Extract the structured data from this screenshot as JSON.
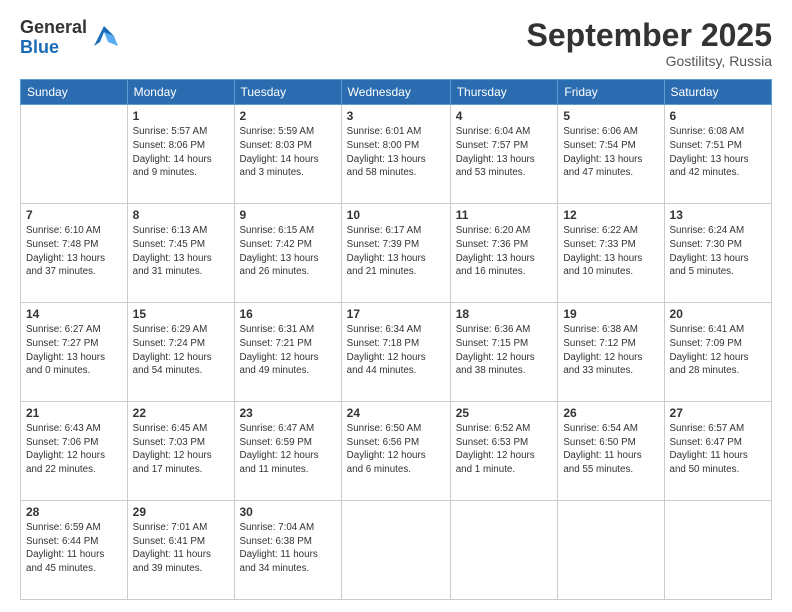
{
  "logo": {
    "general": "General",
    "blue": "Blue"
  },
  "header": {
    "month": "September 2025",
    "location": "Gostilitsy, Russia"
  },
  "weekdays": [
    "Sunday",
    "Monday",
    "Tuesday",
    "Wednesday",
    "Thursday",
    "Friday",
    "Saturday"
  ],
  "weeks": [
    [
      {
        "day": "",
        "info": ""
      },
      {
        "day": "1",
        "info": "Sunrise: 5:57 AM\nSunset: 8:06 PM\nDaylight: 14 hours\nand 9 minutes."
      },
      {
        "day": "2",
        "info": "Sunrise: 5:59 AM\nSunset: 8:03 PM\nDaylight: 14 hours\nand 3 minutes."
      },
      {
        "day": "3",
        "info": "Sunrise: 6:01 AM\nSunset: 8:00 PM\nDaylight: 13 hours\nand 58 minutes."
      },
      {
        "day": "4",
        "info": "Sunrise: 6:04 AM\nSunset: 7:57 PM\nDaylight: 13 hours\nand 53 minutes."
      },
      {
        "day": "5",
        "info": "Sunrise: 6:06 AM\nSunset: 7:54 PM\nDaylight: 13 hours\nand 47 minutes."
      },
      {
        "day": "6",
        "info": "Sunrise: 6:08 AM\nSunset: 7:51 PM\nDaylight: 13 hours\nand 42 minutes."
      }
    ],
    [
      {
        "day": "7",
        "info": "Sunrise: 6:10 AM\nSunset: 7:48 PM\nDaylight: 13 hours\nand 37 minutes."
      },
      {
        "day": "8",
        "info": "Sunrise: 6:13 AM\nSunset: 7:45 PM\nDaylight: 13 hours\nand 31 minutes."
      },
      {
        "day": "9",
        "info": "Sunrise: 6:15 AM\nSunset: 7:42 PM\nDaylight: 13 hours\nand 26 minutes."
      },
      {
        "day": "10",
        "info": "Sunrise: 6:17 AM\nSunset: 7:39 PM\nDaylight: 13 hours\nand 21 minutes."
      },
      {
        "day": "11",
        "info": "Sunrise: 6:20 AM\nSunset: 7:36 PM\nDaylight: 13 hours\nand 16 minutes."
      },
      {
        "day": "12",
        "info": "Sunrise: 6:22 AM\nSunset: 7:33 PM\nDaylight: 13 hours\nand 10 minutes."
      },
      {
        "day": "13",
        "info": "Sunrise: 6:24 AM\nSunset: 7:30 PM\nDaylight: 13 hours\nand 5 minutes."
      }
    ],
    [
      {
        "day": "14",
        "info": "Sunrise: 6:27 AM\nSunset: 7:27 PM\nDaylight: 13 hours\nand 0 minutes."
      },
      {
        "day": "15",
        "info": "Sunrise: 6:29 AM\nSunset: 7:24 PM\nDaylight: 12 hours\nand 54 minutes."
      },
      {
        "day": "16",
        "info": "Sunrise: 6:31 AM\nSunset: 7:21 PM\nDaylight: 12 hours\nand 49 minutes."
      },
      {
        "day": "17",
        "info": "Sunrise: 6:34 AM\nSunset: 7:18 PM\nDaylight: 12 hours\nand 44 minutes."
      },
      {
        "day": "18",
        "info": "Sunrise: 6:36 AM\nSunset: 7:15 PM\nDaylight: 12 hours\nand 38 minutes."
      },
      {
        "day": "19",
        "info": "Sunrise: 6:38 AM\nSunset: 7:12 PM\nDaylight: 12 hours\nand 33 minutes."
      },
      {
        "day": "20",
        "info": "Sunrise: 6:41 AM\nSunset: 7:09 PM\nDaylight: 12 hours\nand 28 minutes."
      }
    ],
    [
      {
        "day": "21",
        "info": "Sunrise: 6:43 AM\nSunset: 7:06 PM\nDaylight: 12 hours\nand 22 minutes."
      },
      {
        "day": "22",
        "info": "Sunrise: 6:45 AM\nSunset: 7:03 PM\nDaylight: 12 hours\nand 17 minutes."
      },
      {
        "day": "23",
        "info": "Sunrise: 6:47 AM\nSunset: 6:59 PM\nDaylight: 12 hours\nand 11 minutes."
      },
      {
        "day": "24",
        "info": "Sunrise: 6:50 AM\nSunset: 6:56 PM\nDaylight: 12 hours\nand 6 minutes."
      },
      {
        "day": "25",
        "info": "Sunrise: 6:52 AM\nSunset: 6:53 PM\nDaylight: 12 hours\nand 1 minute."
      },
      {
        "day": "26",
        "info": "Sunrise: 6:54 AM\nSunset: 6:50 PM\nDaylight: 11 hours\nand 55 minutes."
      },
      {
        "day": "27",
        "info": "Sunrise: 6:57 AM\nSunset: 6:47 PM\nDaylight: 11 hours\nand 50 minutes."
      }
    ],
    [
      {
        "day": "28",
        "info": "Sunrise: 6:59 AM\nSunset: 6:44 PM\nDaylight: 11 hours\nand 45 minutes."
      },
      {
        "day": "29",
        "info": "Sunrise: 7:01 AM\nSunset: 6:41 PM\nDaylight: 11 hours\nand 39 minutes."
      },
      {
        "day": "30",
        "info": "Sunrise: 7:04 AM\nSunset: 6:38 PM\nDaylight: 11 hours\nand 34 minutes."
      },
      {
        "day": "",
        "info": ""
      },
      {
        "day": "",
        "info": ""
      },
      {
        "day": "",
        "info": ""
      },
      {
        "day": "",
        "info": ""
      }
    ]
  ]
}
